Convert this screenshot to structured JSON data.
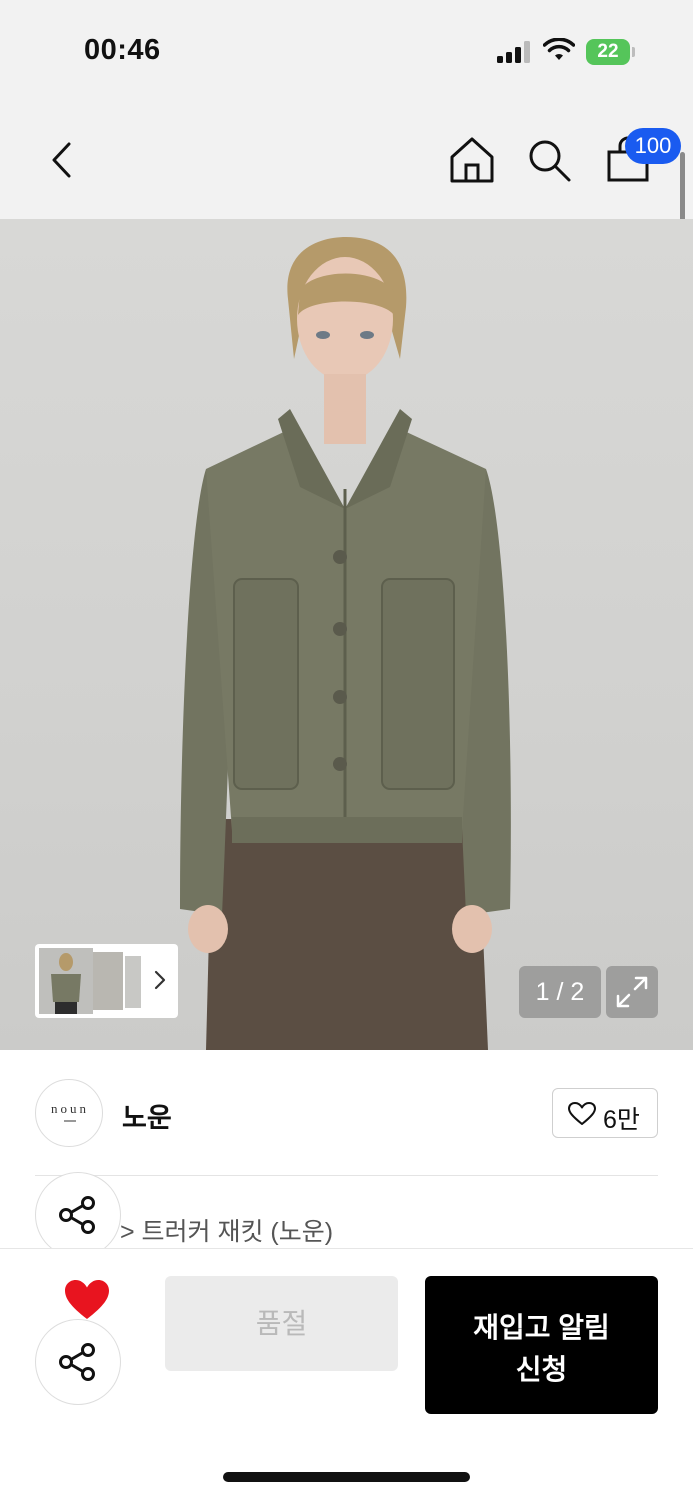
{
  "status_bar": {
    "time": "00:46",
    "battery_level": "22",
    "battery_color": "#55c55a"
  },
  "nav": {
    "back_icon": "chevron-left-icon",
    "home_icon": "home-icon",
    "search_icon": "search-icon",
    "cart_icon": "shopping-bag-icon",
    "cart_count": "100",
    "badge_color": "#1a5bf0"
  },
  "gallery": {
    "page_indicator": "1 / 2",
    "expand_icon": "expand-icon",
    "thumbnail_next_icon": "chevron-right-icon"
  },
  "brand": {
    "logo_text": "noun",
    "name": "노운",
    "like_icon": "heart-outline-icon",
    "like_count": "6만"
  },
  "product": {
    "breadcrumb": "> 트러커 재킷 (노운)"
  },
  "actions": {
    "wishlist_icon": "heart-filled-icon",
    "wishlist_color": "#e8141f",
    "share_icon": "share-icon",
    "soldout_label": "품절",
    "restock_line1": "재입고 알림",
    "restock_line2": "신청"
  }
}
